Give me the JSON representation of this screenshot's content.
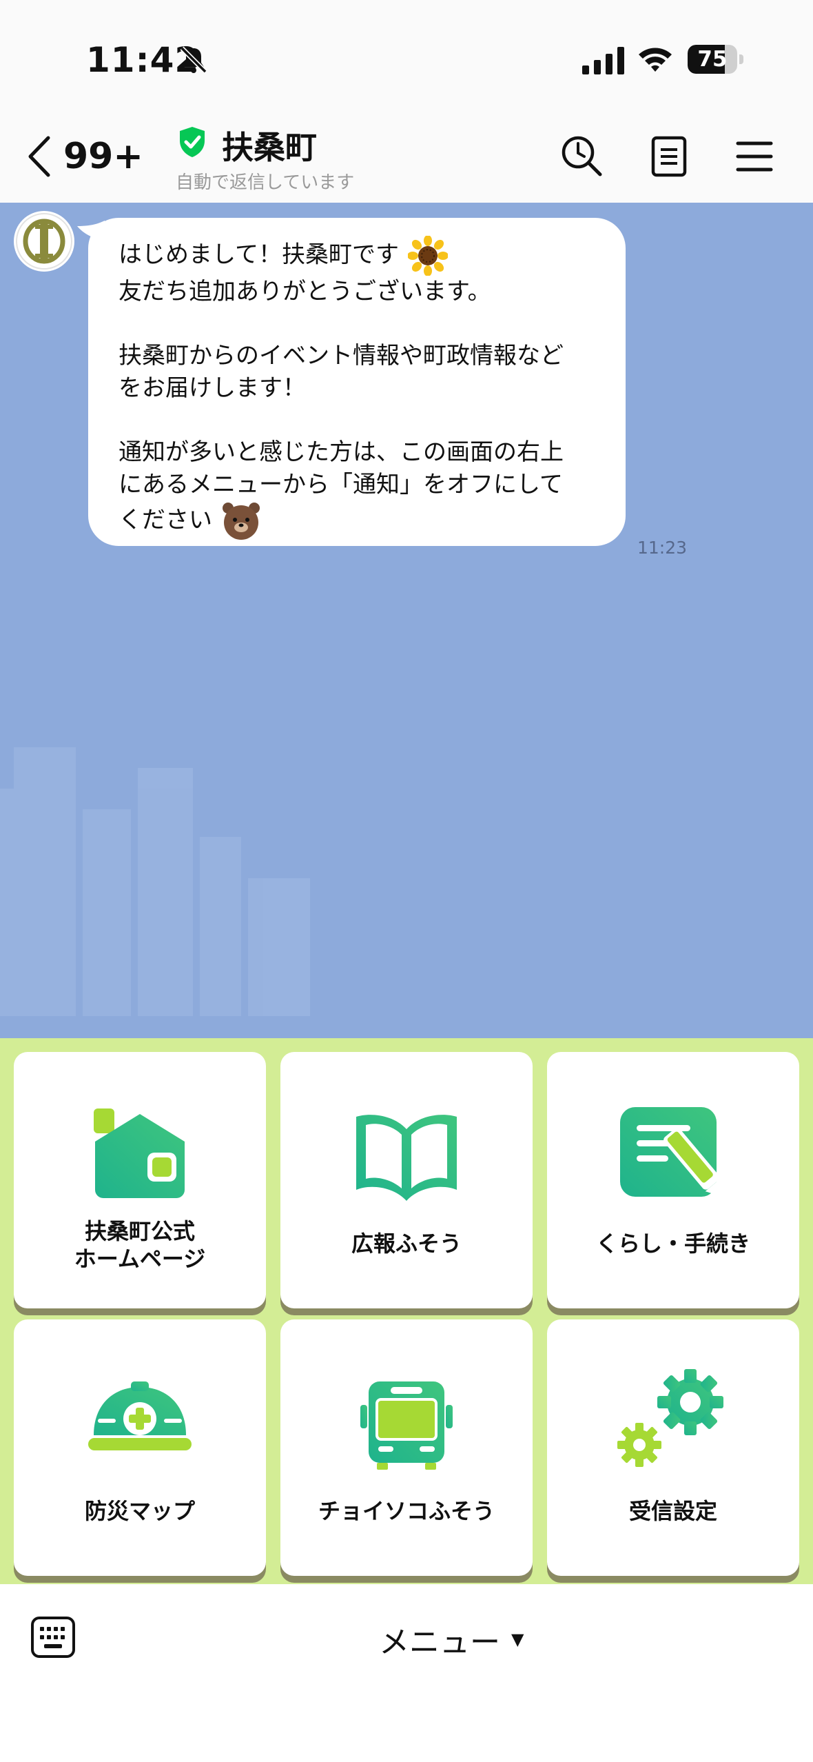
{
  "status_bar": {
    "time": "11:42",
    "battery_level": "75",
    "battery_fraction": 0.75
  },
  "header": {
    "unread_count": "99+",
    "title": "扶桑町",
    "subtitle": "自動で返信しています",
    "icons": [
      "chevron-left-icon",
      "verified-shield-icon",
      "search-clock-icon",
      "notes-icon",
      "hamburger-menu-icon"
    ]
  },
  "message": {
    "lines": [
      "はじめまして！扶桑町です",
      "友だち追加ありがとうございます。",
      "",
      "扶桑町からのイベント情報や町政情報など",
      "をお届けします！",
      "",
      "通知が多いと感じた方は、この画面の右上",
      "にあるメニューから「通知」をオフにして",
      "ください"
    ],
    "emojis": [
      "sunflower-emoji",
      "brown-bear-emoji"
    ],
    "time": "11:23"
  },
  "rich_menu": {
    "tiles": [
      {
        "line1": "扶桑町公式",
        "line2": "ホームページ",
        "icon": "house-icon"
      },
      {
        "line1": "広報ふそう",
        "line2": "",
        "icon": "open-book-icon"
      },
      {
        "line1": "くらし・手続き",
        "line2": "",
        "icon": "document-pencil-icon"
      },
      {
        "line1": "防災マップ",
        "line2": "",
        "icon": "helmet-icon"
      },
      {
        "line1": "チョイソコふそう",
        "line2": "",
        "icon": "bus-icon"
      },
      {
        "line1": "受信設定",
        "line2": "",
        "icon": "gears-icon"
      }
    ]
  },
  "bottom_bar": {
    "menu_label": "メニュー",
    "caret": "▼"
  },
  "colors": {
    "chat_background": "#8daadb",
    "rich_menu_background": "#d3ed95",
    "icon_gradient_start": "#1fb38c",
    "icon_gradient_end": "#a6d934",
    "verified_green": "#06c755"
  }
}
